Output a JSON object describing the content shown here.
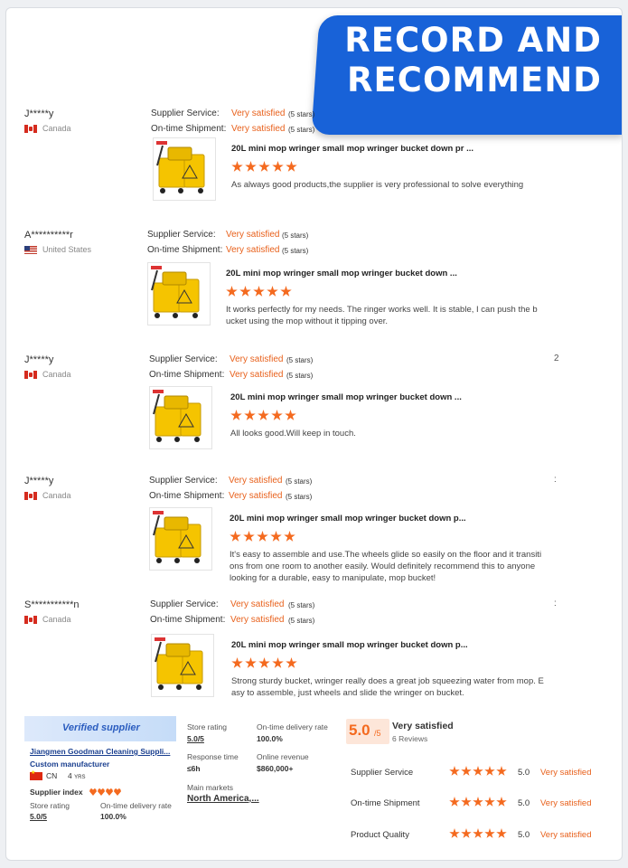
{
  "banner": {
    "line1": "RECORD AND",
    "line2": "RECOMMEND"
  },
  "labels": {
    "supplier_service": "Supplier Service:",
    "ontime_shipment": "On-time Shipment:"
  },
  "reviews": [
    {
      "user": "J*****y",
      "country": "Canada",
      "flag": "ca",
      "service_value": "Very satisfied",
      "service_stars": "(5 stars)",
      "shipment_value": "Very satisfied",
      "shipment_stars": "(5 stars)",
      "product_title": "20L mini mop wringer small mop wringer bucket down pr ...",
      "rating": 5,
      "text_lines": [
        "As always good products,the supplier is very professional to solve everything"
      ],
      "side": ""
    },
    {
      "user": "A**********r",
      "country": "United States",
      "flag": "us",
      "service_value": "Very satisfied",
      "service_stars": "(5 stars)",
      "shipment_value": "Very satisfied",
      "shipment_stars": "(5 stars)",
      "product_title": "20L mini mop wringer small mop wringer bucket down ...",
      "rating": 5,
      "text_lines": [
        "It works perfectly for my needs. The ringer works well. It is stable, I can push the b",
        "ucket using the mop without it tipping over."
      ],
      "side": ""
    },
    {
      "user": "J*****y",
      "country": "Canada",
      "flag": "ca",
      "service_value": "Very satisfied",
      "service_stars": "(5 stars)",
      "shipment_value": "Very satisfied",
      "shipment_stars": "(5 stars)",
      "product_title": "20L mini mop wringer small mop wringer bucket down ...",
      "rating": 5,
      "text_lines": [
        "All looks good.Will keep in touch."
      ],
      "side": "2"
    },
    {
      "user": "J*****y",
      "country": "Canada",
      "flag": "ca",
      "service_value": "Very satisfied",
      "service_stars": "(5 stars)",
      "shipment_value": "Very satisfied",
      "shipment_stars": "(5 stars)",
      "product_title": "20L mini mop wringer small mop wringer bucket down p...",
      "rating": 5,
      "text_lines": [
        "It's easy to assemble and use.The wheels glide so easily on the floor and it transiti",
        "ons from one room to another easily.  Would definitely recommend this to anyone",
        "looking for a durable, easy to manipulate, mop bucket!"
      ],
      "side": ":"
    },
    {
      "user": "S***********n",
      "country": "Canada",
      "flag": "ca",
      "service_value": "Very satisfied",
      "service_stars": "(5 stars)",
      "shipment_value": "Very satisfied",
      "shipment_stars": "(5 stars)",
      "product_title": "20L mini mop wringer small mop wringer bucket down p...",
      "rating": 5,
      "text_lines": [
        "Strong sturdy bucket, wringer really does a great job squeezing water from mop. E",
        "asy to assemble, just wheels and slide the wringer on bucket."
      ],
      "side": ":"
    }
  ],
  "supplier_card": {
    "badge": "Verified supplier",
    "name": "Jiangmen Goodman Cleaning Suppli...",
    "type": "Custom manufacturer",
    "country_code": "CN",
    "years": "4",
    "years_unit": "YRS",
    "index_label": "Supplier index",
    "hearts": 4,
    "store_rating_label": "Store rating",
    "store_rating_value": "5.0/5",
    "delivery_label": "On-time delivery rate",
    "delivery_value": "100.0%"
  },
  "metrics": {
    "store_rating_label": "Store rating",
    "store_rating_value": "5.0/5",
    "delivery_label": "On-time delivery rate",
    "delivery_value": "100.0%",
    "response_label": "Response time",
    "response_value": "≤6h",
    "revenue_label": "Online revenue",
    "revenue_value": "$860,000+",
    "markets_label": "Main markets",
    "markets_value": "North America,..."
  },
  "summary": {
    "score": "5.0",
    "score_suffix": "/5",
    "verdict": "Very satisfied",
    "reviews": "6 Reviews",
    "rows": [
      {
        "label": "Supplier Service",
        "score": "5.0",
        "verdict": "Very satisfied"
      },
      {
        "label": "On-time Shipment",
        "score": "5.0",
        "verdict": "Very satisfied"
      },
      {
        "label": "Product Quality",
        "score": "5.0",
        "verdict": "Very satisfied"
      }
    ]
  },
  "colors": {
    "accent": "#f46a1f",
    "banner": "#1862d8",
    "link_blue": "#2a5cbf"
  }
}
